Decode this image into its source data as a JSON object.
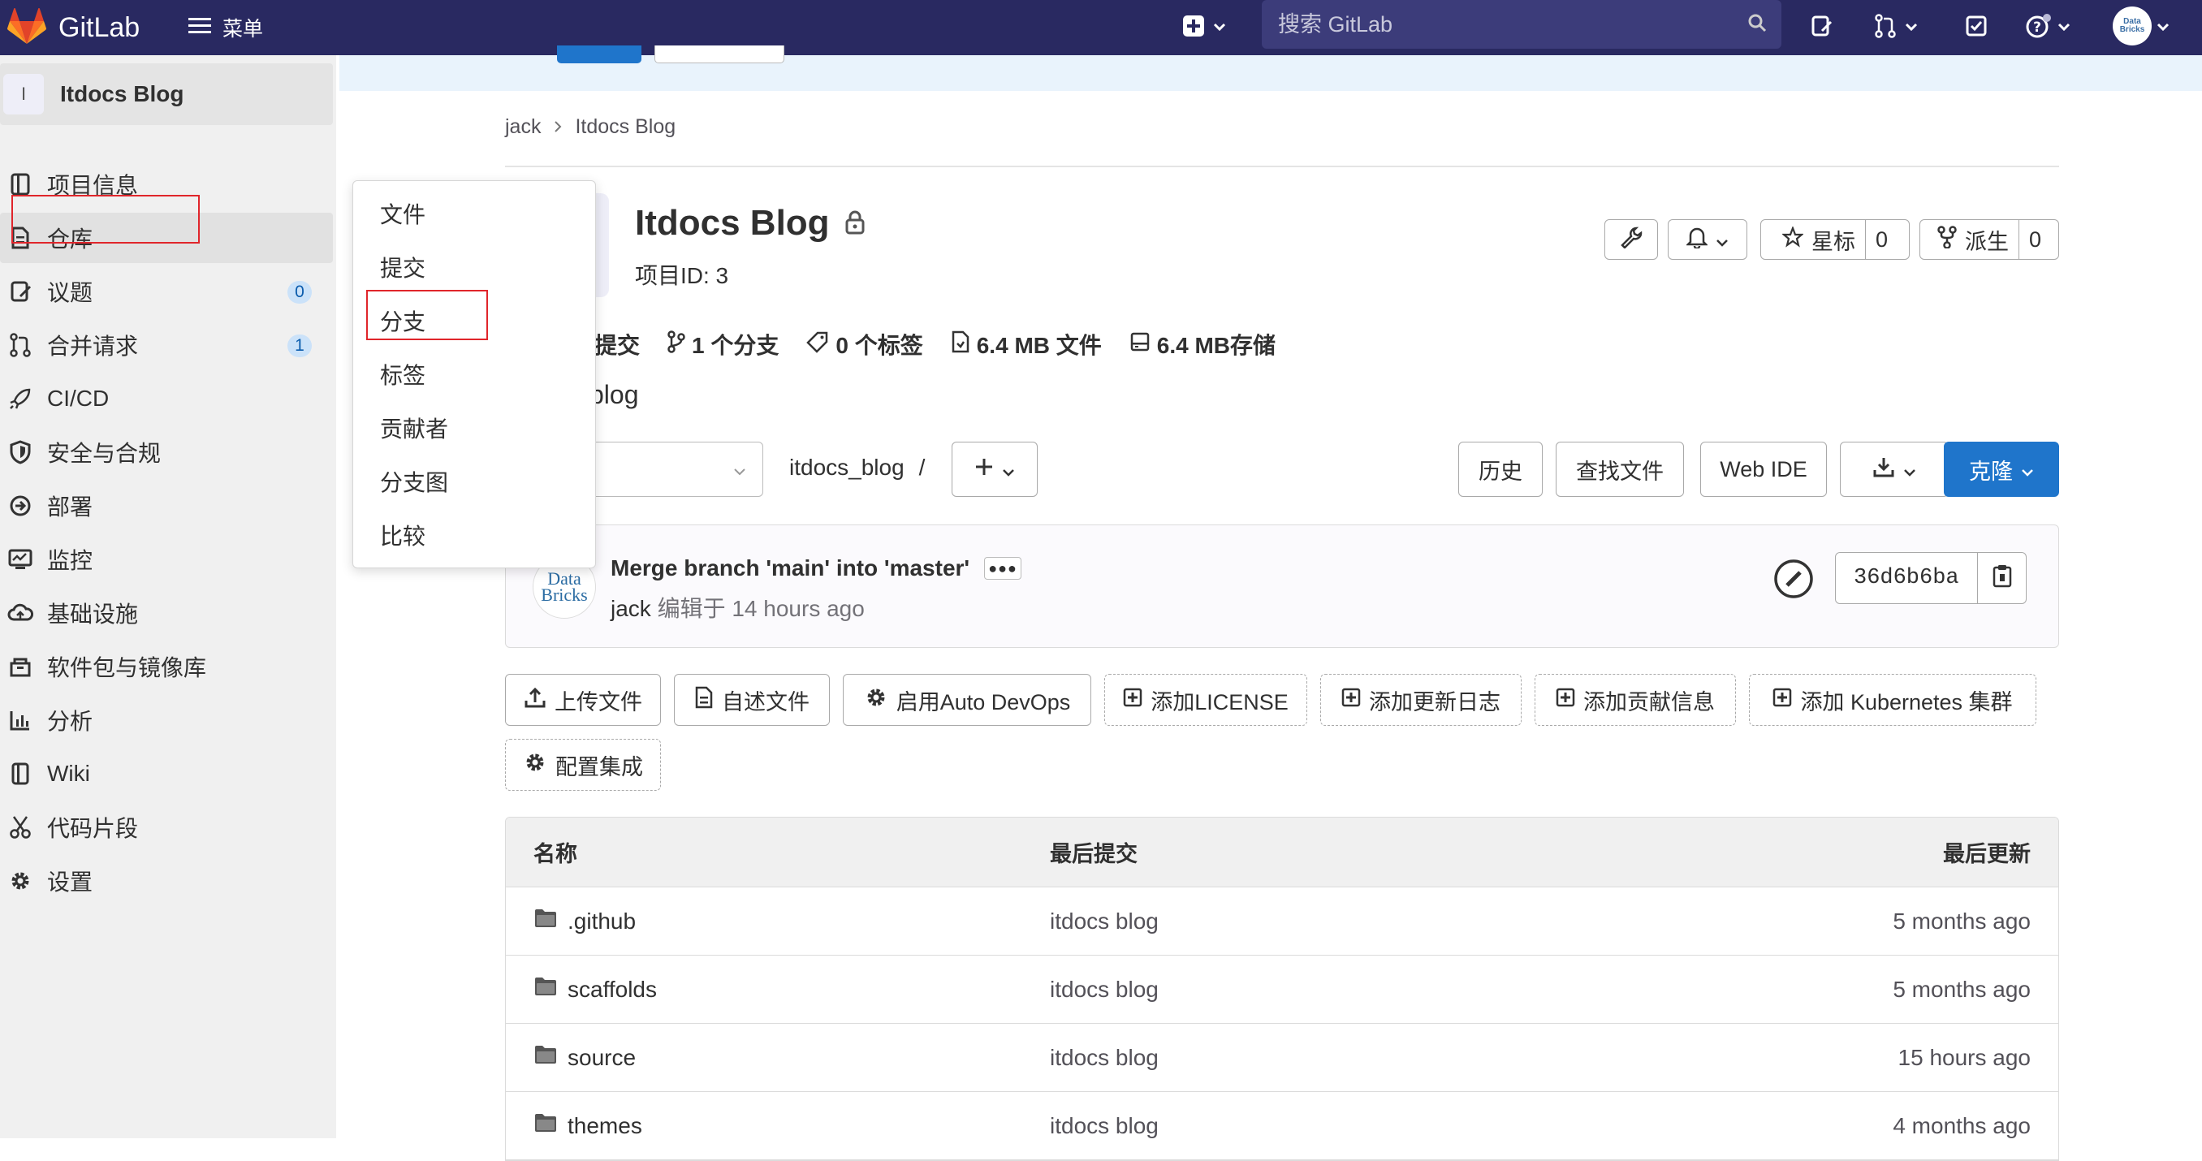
{
  "navbar": {
    "brand": "GitLab",
    "menu_label": "菜单",
    "search_placeholder": "搜索 GitLab",
    "avatar_text": "Data Bricks"
  },
  "sidebar": {
    "project_avatar": "I",
    "project_name": "Itdocs Blog",
    "items": [
      {
        "label": "项目信息",
        "icon": "info-icon"
      },
      {
        "label": "仓库",
        "icon": "repository-icon"
      },
      {
        "label": "议题",
        "icon": "issues-icon",
        "count": "0"
      },
      {
        "label": "合并请求",
        "icon": "merge-request-icon",
        "count": "1"
      },
      {
        "label": "CI/CD",
        "icon": "rocket-icon"
      },
      {
        "label": "安全与合规",
        "icon": "shield-icon"
      },
      {
        "label": "部署",
        "icon": "deploy-icon"
      },
      {
        "label": "监控",
        "icon": "monitor-icon"
      },
      {
        "label": "基础设施",
        "icon": "cloud-icon"
      },
      {
        "label": "软件包与镜像库",
        "icon": "package-icon"
      },
      {
        "label": "分析",
        "icon": "chart-icon"
      },
      {
        "label": "Wiki",
        "icon": "book-icon"
      },
      {
        "label": "代码片段",
        "icon": "scissors-icon"
      },
      {
        "label": "设置",
        "icon": "gear-icon"
      }
    ]
  },
  "flyout": {
    "items": [
      "文件",
      "提交",
      "分支",
      "标签",
      "贡献者",
      "分支图",
      "比较"
    ]
  },
  "breadcrumb": {
    "parent": "jack",
    "current": "Itdocs Blog"
  },
  "project": {
    "title": "Itdocs Blog",
    "id_label": "项目ID: 3",
    "star_label": "星标",
    "star_count": "0",
    "fork_label": "派生",
    "fork_count": "0",
    "description": "blog"
  },
  "stats": {
    "commits": "提交",
    "branches": "1 个分支",
    "tags": "0 个标签",
    "files": "6.4 MB 文件",
    "storage": "6.4 MB存储"
  },
  "repo_bar": {
    "path_root": "itdocs_blog",
    "path_sep": "/",
    "history": "历史",
    "find_file": "查找文件",
    "web_ide": "Web IDE",
    "clone": "克隆"
  },
  "last_commit": {
    "title": "Merge branch 'main' into 'master'",
    "author": "jack",
    "edited": "编辑于 14 hours ago",
    "sha": "36d6b6ba",
    "avatar_line1": "Data",
    "avatar_line2": "Bricks"
  },
  "actions": [
    {
      "label": "上传文件",
      "icon": "upload-icon"
    },
    {
      "label": "自述文件",
      "icon": "document-icon"
    },
    {
      "label": "启用Auto DevOps",
      "icon": "gear-icon"
    },
    {
      "label": "添加LICENSE",
      "icon": "plus-square-icon"
    },
    {
      "label": "添加更新日志",
      "icon": "plus-square-icon"
    },
    {
      "label": "添加贡献信息",
      "icon": "plus-square-icon"
    },
    {
      "label": "添加 Kubernetes 集群",
      "icon": "plus-square-icon"
    },
    {
      "label": "配置集成",
      "icon": "gear-icon"
    }
  ],
  "file_table": {
    "headers": [
      "名称",
      "最后提交",
      "最后更新"
    ],
    "rows": [
      {
        "name": ".github",
        "commit": "itdocs blog",
        "updated": "5 months ago"
      },
      {
        "name": "scaffolds",
        "commit": "itdocs blog",
        "updated": "5 months ago"
      },
      {
        "name": "source",
        "commit": "itdocs blog",
        "updated": "15 hours ago"
      },
      {
        "name": "themes",
        "commit": "itdocs blog",
        "updated": "4 months ago"
      }
    ]
  },
  "colors": {
    "navbar": "#292961",
    "primary": "#1f75cb",
    "highlight_box": "#e0252b"
  }
}
